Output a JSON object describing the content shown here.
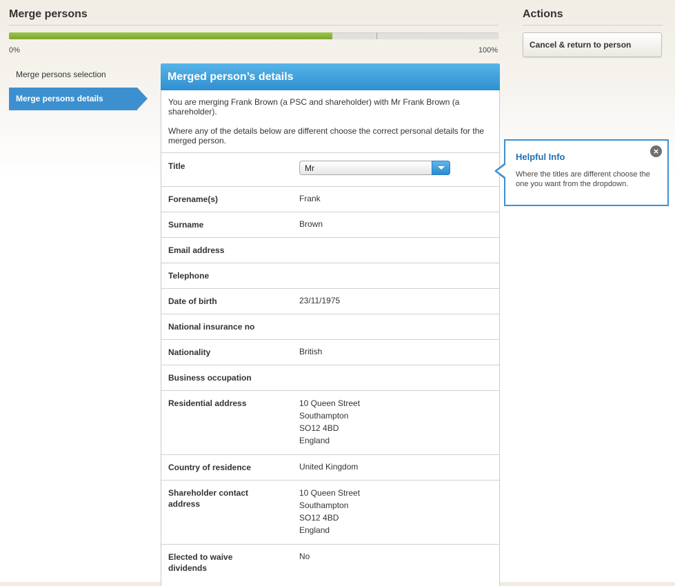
{
  "header": {
    "title": "Merge persons"
  },
  "progress": {
    "fraction": 0.66,
    "start_label": "0%",
    "end_label": "100%"
  },
  "steps": [
    {
      "label": "Merge persons selection",
      "active": false
    },
    {
      "label": "Merge persons details",
      "active": true
    }
  ],
  "panel": {
    "title": "Merged person’s details",
    "intro_1": "You are merging Frank Brown (a PSC and shareholder) with Mr Frank Brown (a shareholder).",
    "intro_2": "Where any of the details below are different choose the correct personal details for the merged person.",
    "title_field": {
      "label": "Title",
      "value": "Mr"
    },
    "rows": [
      {
        "label": "Forename(s)",
        "value": "Frank"
      },
      {
        "label": "Surname",
        "value": "Brown"
      },
      {
        "label": "Email address",
        "value": ""
      },
      {
        "label": "Telephone",
        "value": ""
      },
      {
        "label": "Date of birth",
        "value": "23/11/1975"
      },
      {
        "label": "National insurance no",
        "value": ""
      },
      {
        "label": "Nationality",
        "value": "British"
      },
      {
        "label": "Business occupation",
        "value": ""
      },
      {
        "label": "Residential address",
        "value": [
          "10 Queen Street",
          "Southampton",
          "SO12 4BD",
          "England"
        ]
      },
      {
        "label": "Country of residence",
        "value": "United Kingdom"
      },
      {
        "label": "Shareholder contact address",
        "value": [
          "10 Queen Street",
          "Southampton",
          "SO12 4BD",
          "England"
        ]
      },
      {
        "label": "Elected to waive dividends",
        "value": "No"
      }
    ]
  },
  "actions": {
    "title": "Actions",
    "cancel_label": "Cancel & return to person"
  },
  "helpful_info": {
    "title": "Helpful Info",
    "text": "Where the titles are different choose the one you want from the dropdown.",
    "close_icon": "close-icon"
  }
}
